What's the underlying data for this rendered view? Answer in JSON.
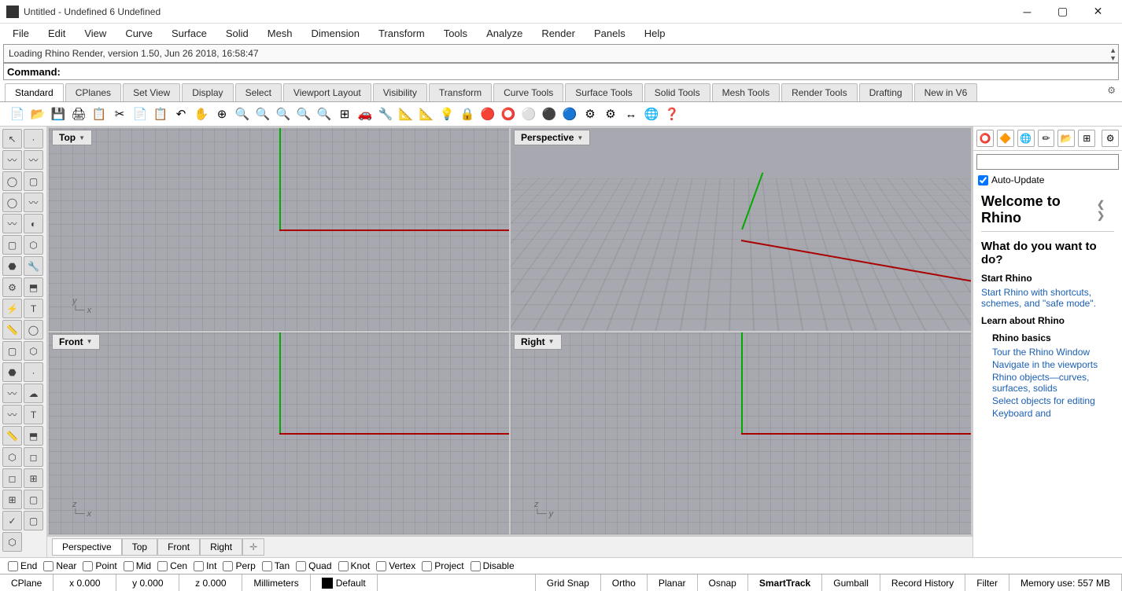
{
  "title": "Untitled - Undefined 6 Undefined",
  "menu": [
    "File",
    "Edit",
    "View",
    "Curve",
    "Surface",
    "Solid",
    "Mesh",
    "Dimension",
    "Transform",
    "Tools",
    "Analyze",
    "Render",
    "Panels",
    "Help"
  ],
  "history": "Loading Rhino Render, version 1.50, Jun 26 2018, 16:58:47",
  "command_label": "Command:",
  "tabs": [
    "Standard",
    "CPlanes",
    "Set View",
    "Display",
    "Select",
    "Viewport Layout",
    "Visibility",
    "Transform",
    "Curve Tools",
    "Surface Tools",
    "Solid Tools",
    "Mesh Tools",
    "Render Tools",
    "Drafting",
    "New in V6"
  ],
  "active_tab": 0,
  "viewport_labels": {
    "top": "Top",
    "perspective": "Perspective",
    "front": "Front",
    "right": "Right"
  },
  "vptabs": [
    "Perspective",
    "Top",
    "Front",
    "Right"
  ],
  "osnaps": [
    "End",
    "Near",
    "Point",
    "Mid",
    "Cen",
    "Int",
    "Perp",
    "Tan",
    "Quad",
    "Knot",
    "Vertex",
    "Project",
    "Disable"
  ],
  "autoupdate": "Auto-Update",
  "help": {
    "welcome_title": "Welcome to Rhino",
    "q": "What do you want to do?",
    "start_h": "Start Rhino",
    "start_link": "Start Rhino with shortcuts, schemes, and \"safe mode\".",
    "learn_h": "Learn about Rhino",
    "basics_h": "Rhino basics",
    "links": [
      "Tour the Rhino Window",
      "Navigate in the viewports",
      "Rhino objects—curves, surfaces, solids",
      "Select objects for editing",
      "Keyboard and"
    ]
  },
  "status": {
    "cplane": "CPlane",
    "x": "x 0.000",
    "y": "y 0.000",
    "z": "z 0.000",
    "units": "Millimeters",
    "layer": "Default",
    "modes": [
      "Grid Snap",
      "Ortho",
      "Planar",
      "Osnap",
      "SmartTrack",
      "Gumball",
      "Record History",
      "Filter"
    ],
    "active_mode": "SmartTrack",
    "memory": "Memory use: 557 MB"
  },
  "toolbar_icons": [
    "📄",
    "📂",
    "💾",
    "🖨",
    "📋",
    "✂",
    "📄",
    "📋",
    "↶",
    "✋",
    "⊕",
    "🔍",
    "🔍",
    "🔍",
    "🔍",
    "🔍",
    "⊞",
    "🚗",
    "🔧",
    "📐",
    "📐",
    "💡",
    "🔒",
    "🔴",
    "⭕",
    "⚪",
    "⚫",
    "🔵",
    "⚙",
    "⚙",
    "↔",
    "🌐",
    "❓"
  ],
  "left_icons": [
    "↖",
    "·",
    "〰",
    "〰",
    "◯",
    "▢",
    "◯",
    "〰",
    "〰",
    "◐",
    "▢",
    "⬡",
    "⬣",
    "🔧",
    "⚙",
    "⬒",
    "⚡",
    "T",
    "📏",
    "◯",
    "▢",
    "⬡",
    "⬣",
    "·",
    "〰",
    "☁",
    "〰",
    "T",
    "📏",
    "⬒",
    "⬡",
    "◻",
    "◻",
    "⊞",
    "⊞",
    "▢",
    "✓",
    "▢",
    "⬡"
  ],
  "right_icons": [
    "⭕",
    "🔶",
    "🌐",
    "✏",
    "📂",
    "⊞"
  ]
}
